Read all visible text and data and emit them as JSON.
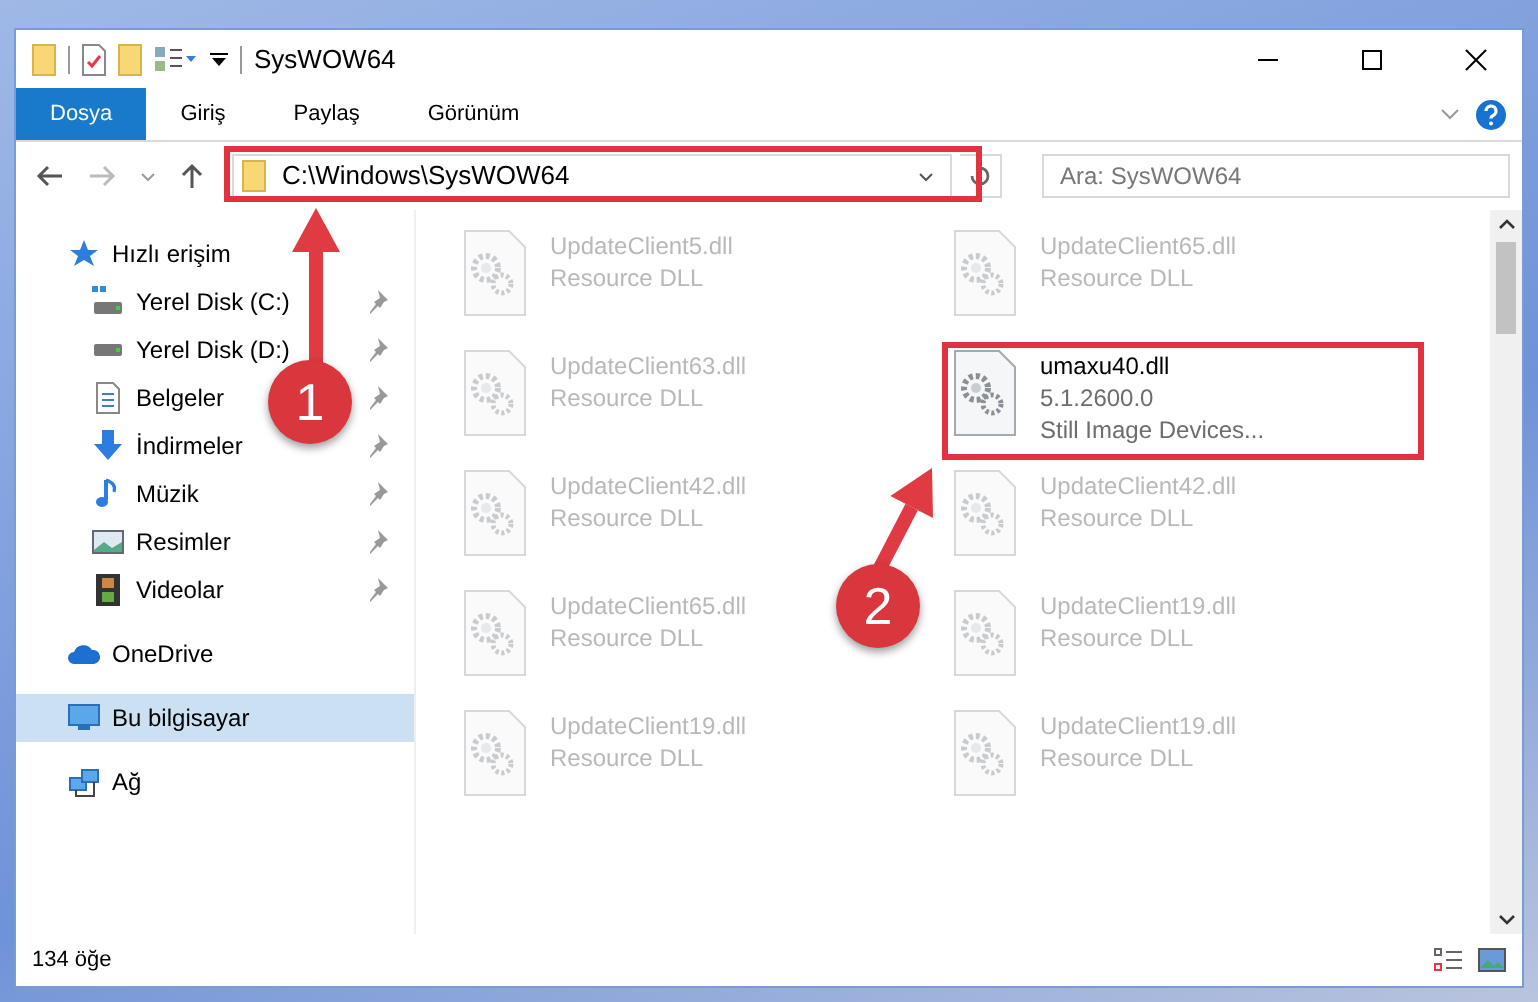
{
  "window": {
    "title": "SysWOW64"
  },
  "ribbon_tabs": [
    {
      "label": "Dosya",
      "kind": "file"
    },
    {
      "label": "Giriş",
      "kind": "tab"
    },
    {
      "label": "Paylaş",
      "kind": "tab"
    },
    {
      "label": "Görünüm",
      "kind": "tab"
    }
  ],
  "address_bar": {
    "path": "C:\\Windows\\SysWOW64"
  },
  "search": {
    "placeholder": "Ara: SysWOW64"
  },
  "sidebar": {
    "items": [
      {
        "label": "Hızlı erişim",
        "selected": false,
        "children": [
          {
            "label": "Yerel Disk (C:)",
            "selected": false,
            "pinned": true
          },
          {
            "label": "Yerel Disk (D:)",
            "selected": false,
            "pinned": true
          },
          {
            "label": "Belgeler",
            "selected": false,
            "pinned": true
          },
          {
            "label": "İndirmeler",
            "selected": false,
            "pinned": true
          },
          {
            "label": "Müzik",
            "selected": false,
            "pinned": true
          },
          {
            "label": "Resimler",
            "selected": false,
            "pinned": true
          },
          {
            "label": "Videolar",
            "selected": false,
            "pinned": true
          }
        ]
      },
      {
        "label": "OneDrive",
        "selected": false
      },
      {
        "label": "Bu bilgisayar",
        "selected": true
      },
      {
        "label": "Ağ",
        "selected": false
      }
    ]
  },
  "files": [
    {
      "name": "UpdateClient5.dll",
      "details": [
        "Resource DLL"
      ],
      "blurred": true
    },
    {
      "name": "UpdateClient65.dll",
      "details": [
        "Resource DLL"
      ],
      "blurred": true
    },
    {
      "name": "UpdateClient63.dll",
      "details": [
        "Resource DLL"
      ],
      "blurred": true
    },
    {
      "name": "umaxu40.dll",
      "details": [
        "5.1.2600.0",
        "Still Image Devices..."
      ],
      "blurred": false
    },
    {
      "name": "UpdateClient42.dll",
      "details": [
        "Resource DLL"
      ],
      "blurred": true
    },
    {
      "name": "UpdateClient42.dll",
      "details": [
        "Resource DLL"
      ],
      "blurred": true
    },
    {
      "name": "UpdateClient65.dll",
      "details": [
        "Resource DLL"
      ],
      "blurred": true
    },
    {
      "name": "UpdateClient19.dll",
      "details": [
        "Resource DLL"
      ],
      "blurred": true
    },
    {
      "name": "UpdateClient19.dll",
      "details": [
        "Resource DLL"
      ],
      "blurred": true
    },
    {
      "name": "UpdateClient19.dll",
      "details": [
        "Resource DLL"
      ],
      "blurred": true
    }
  ],
  "status_bar": {
    "item_count": "134 öğe"
  },
  "annotations": [
    {
      "label": "1"
    },
    {
      "label": "2"
    }
  ]
}
